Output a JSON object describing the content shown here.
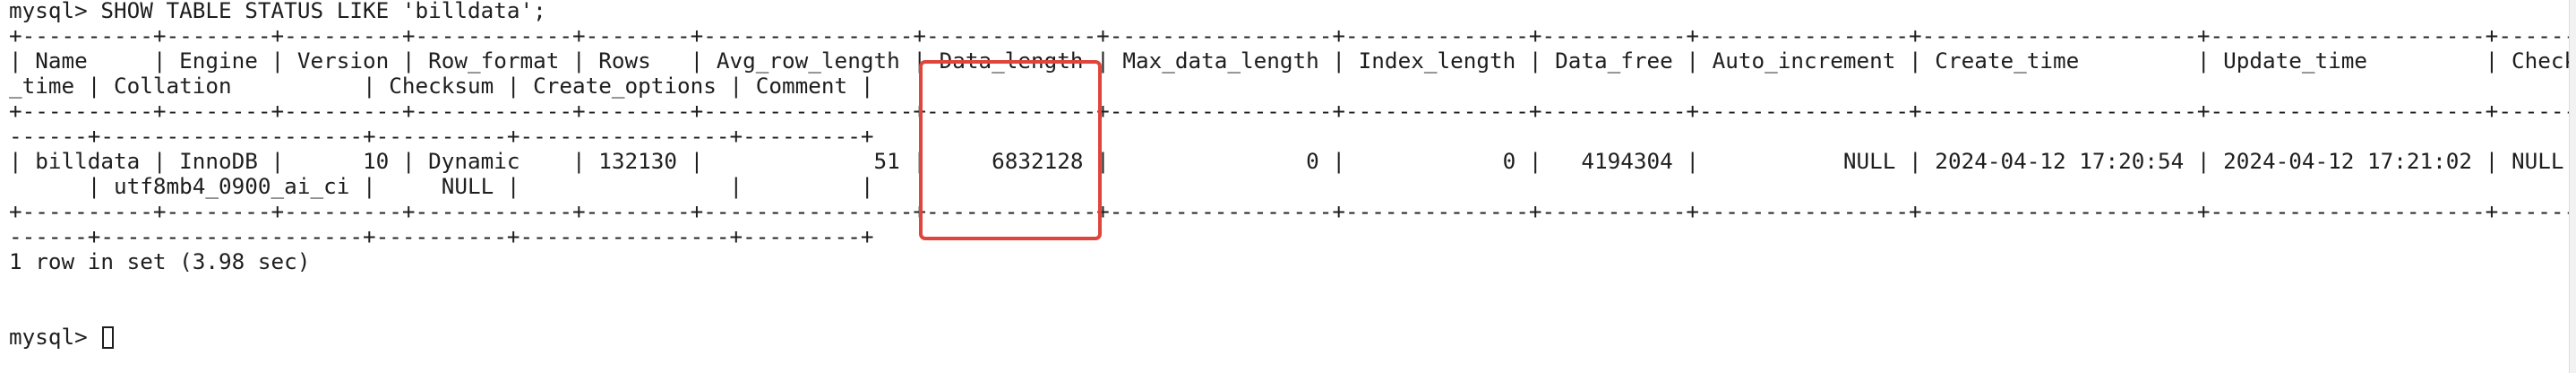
{
  "terminal": {
    "command_line": "mysql> SHOW TABLE STATUS LIKE 'billdata';",
    "border_line": "+----------+--------+---------+------------+--------+----------------+-------------+-----------------+--------------+-----------+----------------+---------------------+---------------------+--------------------",
    "header_line_1": "| Name     | Engine | Version | Row_format | Rows   | Avg_row_length | Data_length | Max_data_length | Index_length | Data_free | Auto_increment | Create_time         | Update_time         | Check",
    "header_line_2": "_time | Collation          | Checksum | Create_options | Comment |",
    "border_tail": "------+--------------------+----------+----------------+---------+",
    "row_line_1": "| billdata | InnoDB |      10 | Dynamic    | 132130 |             51 |     6832128 |               0 |            0 |   4194304 |           NULL | 2024-04-12 17:20:54 | 2024-04-12 17:21:02 | NULL",
    "row_line_2": "      | utf8mb4_0900_ai_ci |     NULL |                |         |",
    "result_summary": "1 row in set (3.98 sec)",
    "prompt": "mysql> "
  },
  "highlight": {
    "label": "Data_length",
    "color": "#e0453c"
  },
  "colors": {
    "background": "#ffffff",
    "text": "#1e1e1e"
  }
}
